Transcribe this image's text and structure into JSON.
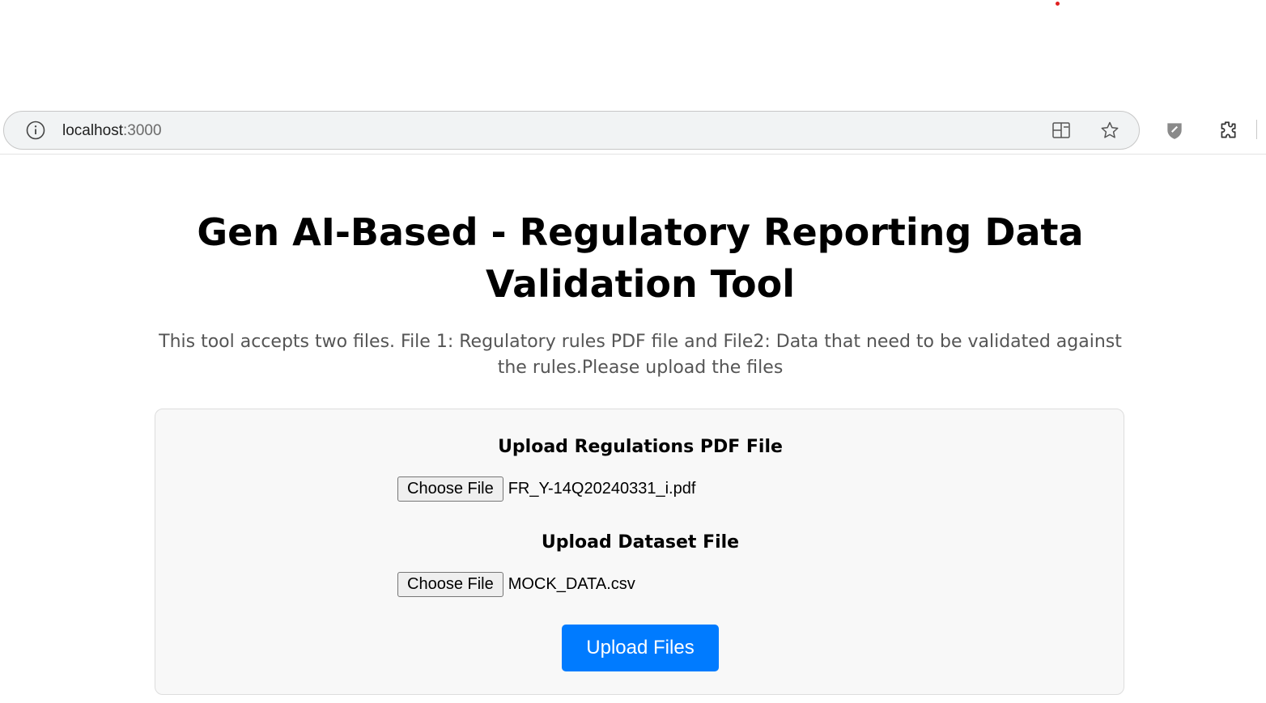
{
  "browser": {
    "url_host": "localhost",
    "url_port": ":3000",
    "icons": [
      "info-icon",
      "split-screen-icon",
      "favorite-star-icon",
      "browser-essentials-icon",
      "extensions-icon"
    ],
    "recording_dot_color": "#e02020"
  },
  "page": {
    "title": "Gen AI-Based - Regulatory Reporting Data Validation Tool",
    "description": "This tool accepts two files. File 1: Regulatory rules PDF file and File2: Data that need to be validated against the rules.Please upload the files"
  },
  "upload_form": {
    "regulations": {
      "label": "Upload Regulations PDF File",
      "button_label": "Choose File",
      "selected_file": "FR_Y-14Q20240331_i.pdf"
    },
    "dataset": {
      "label": "Upload Dataset File",
      "button_label": "Choose File",
      "selected_file": "MOCK_DATA.csv"
    },
    "submit_label": "Upload Files",
    "accent_color": "#007bff"
  }
}
